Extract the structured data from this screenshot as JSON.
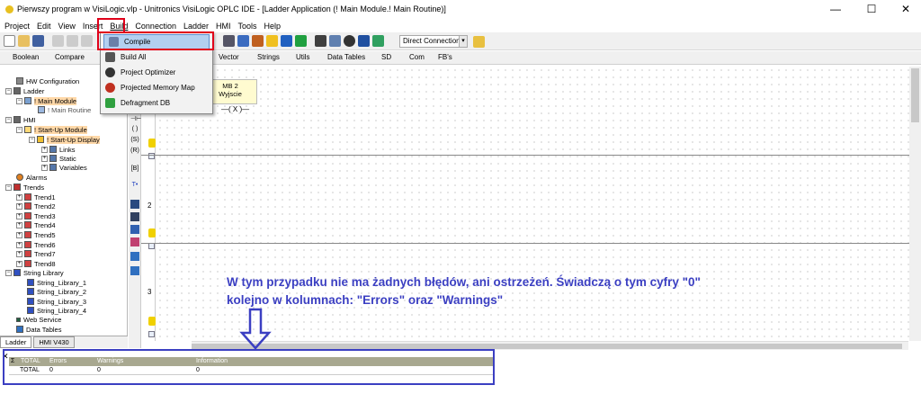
{
  "window": {
    "title": "Pierwszy program w VisiLogic.vlp - Unitronics VisiLogic OPLC IDE - [Ladder Application (! Main Module.! Main Routine)]",
    "minimize_glyph": "—",
    "maximize_glyph": "☐",
    "close_glyph": "✕"
  },
  "menubar": {
    "items": [
      "Project",
      "Edit",
      "View",
      "Insert",
      "Build",
      "Connection",
      "Ladder",
      "HMI",
      "Tools",
      "Help"
    ]
  },
  "toolbar": {
    "connection_value": "Direct Connection"
  },
  "toolbar2": {
    "items": [
      "Boolean",
      "Compare",
      "Vector",
      "Strings",
      "Utils",
      "Data Tables",
      "SD",
      "Com",
      "FB's"
    ]
  },
  "build_menu": {
    "items": [
      "Compile",
      "Build All",
      "Project Optimizer",
      "Projected Memory Map",
      "Defragment DB"
    ],
    "selected": "Compile"
  },
  "project_tree": {
    "items": [
      {
        "label": "HW Configuration",
        "level": 1
      },
      {
        "label": "Ladder",
        "level": 0
      },
      {
        "label": "! Main Module",
        "level": 1
      },
      {
        "label": "! Main Routine",
        "level": 2
      },
      {
        "label": "HMI",
        "level": 0
      },
      {
        "label": "! Start-Up Module",
        "level": 1
      },
      {
        "label": "! Start-Up Display",
        "level": 2
      },
      {
        "label": "Links",
        "level": 3
      },
      {
        "label": "Static",
        "level": 3
      },
      {
        "label": "Variables",
        "level": 3
      },
      {
        "label": "Alarms",
        "level": 1
      },
      {
        "label": "Trends",
        "level": 0
      },
      {
        "label": "Trend1",
        "level": 1
      },
      {
        "label": "Trend2",
        "level": 1
      },
      {
        "label": "Trend3",
        "level": 1
      },
      {
        "label": "Trend4",
        "level": 1
      },
      {
        "label": "Trend5",
        "level": 1
      },
      {
        "label": "Trend6",
        "level": 1
      },
      {
        "label": "Trend7",
        "level": 1
      },
      {
        "label": "Trend8",
        "level": 1
      },
      {
        "label": "String Library",
        "level": 0
      },
      {
        "label": "String_Library_1",
        "level": 1
      },
      {
        "label": "String_Library_2",
        "level": 1
      },
      {
        "label": "String_Library_3",
        "level": 1
      },
      {
        "label": "String_Library_4",
        "level": 1
      },
      {
        "label": "Web Service",
        "level": 1
      },
      {
        "label": "Data Tables",
        "level": 1
      }
    ]
  },
  "panel_tabs": [
    "Ladder",
    "HMI V430"
  ],
  "ladder": {
    "rung_numbers": [
      "2",
      "3"
    ],
    "mb_block": {
      "line1": "MB 2",
      "line2": "Wyjscie"
    },
    "coil_symbol": "—( X )—"
  },
  "errors_panel": {
    "sigma": "Σ",
    "headers": [
      "TOTAL",
      "Errors",
      "Warnings",
      "Information"
    ],
    "row": [
      "TOTAL",
      "0",
      "0",
      "0"
    ]
  },
  "annotation": {
    "line1": "W tym przypadku nie ma żadnych błędów, ani ostrzeżeń. Świadczą o tym cyfry \"0\"",
    "line2": "kolejno w kolumnach: \"Errors\" oraz \"Warnings\""
  },
  "colors": {
    "highlight_red": "#e0001a",
    "annotation_blue": "#3b3fc2"
  }
}
